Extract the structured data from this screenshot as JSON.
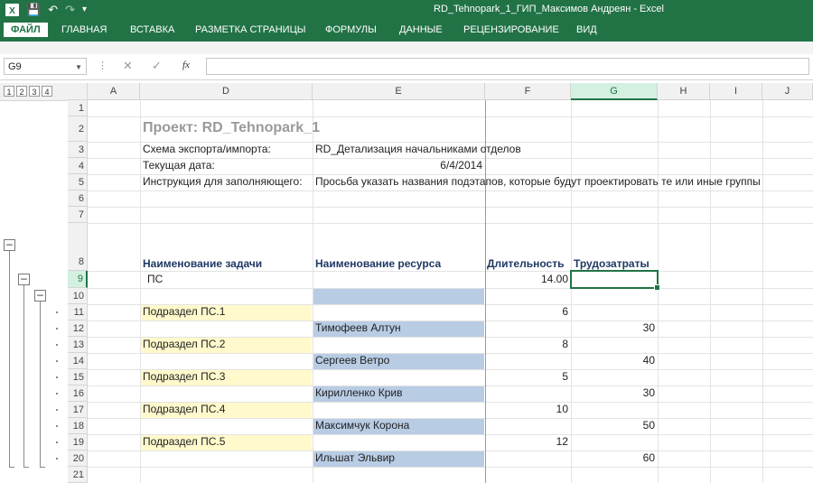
{
  "window": {
    "title": "RD_Tehnopark_1_ГИП_Максимов Андреян - Excel"
  },
  "ribbon": {
    "tabs": [
      "ФАЙЛ",
      "ГЛАВНАЯ",
      "ВСТАВКА",
      "РАЗМЕТКА СТРАНИЦЫ",
      "ФОРМУЛЫ",
      "ДАННЫЕ",
      "РЕЦЕНЗИРОВАНИЕ",
      "ВИД"
    ]
  },
  "formula_bar": {
    "name_box": "G9",
    "fx": "fx",
    "value": ""
  },
  "outline_levels": [
    "1",
    "2",
    "3",
    "4"
  ],
  "columns": [
    "A",
    "D",
    "E",
    "F",
    "G",
    "H",
    "I",
    "J"
  ],
  "rows": [
    "1",
    "2",
    "3",
    "4",
    "5",
    "6",
    "7",
    "8",
    "9",
    "10",
    "11",
    "12",
    "13",
    "14",
    "15",
    "16",
    "17",
    "18",
    "19",
    "20",
    "21"
  ],
  "sheet": {
    "project": "Проект: RD_Tehnopark_1",
    "scheme_label": "Схема экспорта/импорта:",
    "scheme_value": "RD_Детализация начальниками отделов",
    "date_label": "Текущая дата:",
    "date_value": "6/4/2014",
    "instr_label": "Инструкция для заполняющего:",
    "instr_value": "Просьба указать названия подэтапов, которые будут проектировать те или иные группы",
    "headers": {
      "task": "Наименование задачи",
      "resource": "Наименование ресурса",
      "duration": "Длительность",
      "labor": "Трудозатраты"
    },
    "root": {
      "task": "ПС",
      "duration": "14.00"
    },
    "subsections": [
      {
        "task": "Подраздел ПС.1",
        "duration": "6",
        "resource": "Тимофеев Алтун",
        "labor": "30"
      },
      {
        "task": "Подраздел ПС.2",
        "duration": "8",
        "resource": "Сергеев Ветро",
        "labor": "40"
      },
      {
        "task": "Подраздел ПС.3",
        "duration": "5",
        "resource": "Кирилленко Крив",
        "labor": "30"
      },
      {
        "task": "Подраздел ПС.4",
        "duration": "10",
        "resource": "Максимчук Корона",
        "labor": "50"
      },
      {
        "task": "Подраздел ПС.5",
        "duration": "12",
        "resource": "Ильшат Эльвир",
        "labor": "60"
      }
    ]
  },
  "colors": {
    "accent": "#217346",
    "task_fill": "#fff9cc",
    "resource_fill": "#b8cce4",
    "header_text": "#1f3864"
  }
}
